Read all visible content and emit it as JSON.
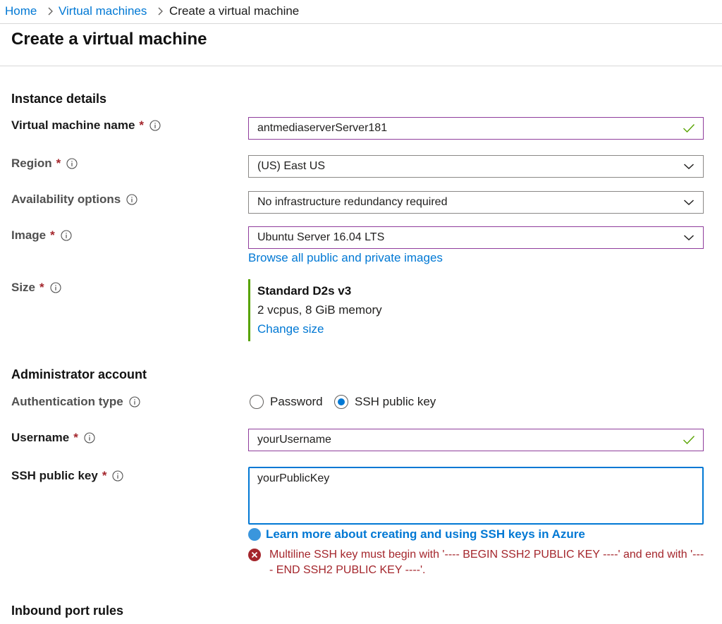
{
  "breadcrumb": {
    "home": "Home",
    "vms": "Virtual machines",
    "current": "Create a virtual machine"
  },
  "page_title": "Create a virtual machine",
  "sections": {
    "instance": "Instance details",
    "admin": "Administrator account",
    "inbound": "Inbound port rules"
  },
  "fields": {
    "vm_name": {
      "label": "Virtual machine name",
      "required": "*",
      "value": "antmediaserverServer181"
    },
    "region": {
      "label": "Region",
      "required": "*",
      "value": "(US) East US"
    },
    "availability": {
      "label": "Availability options",
      "value": "No infrastructure redundancy required"
    },
    "image": {
      "label": "Image",
      "required": "*",
      "value": "Ubuntu Server 16.04 LTS",
      "browse_link": "Browse all public and private images"
    },
    "size": {
      "label": "Size",
      "required": "*",
      "name": "Standard D2s v3",
      "desc": "2 vcpus, 8 GiB memory",
      "change_link": "Change size"
    },
    "auth_type": {
      "label": "Authentication type",
      "options": [
        "Password",
        "SSH public key"
      ],
      "selected": "SSH public key"
    },
    "username": {
      "label": "Username",
      "required": "*",
      "value": "yourUsername"
    },
    "ssh_key": {
      "label": "SSH public key",
      "required": "*",
      "value": "yourPublicKey",
      "learn_more": "Learn more about creating and using SSH keys in Azure",
      "error": "Multiline SSH key must begin with '---- BEGIN SSH2 PUBLIC KEY ----' and end with '---- END SSH2 PUBLIC KEY ----'."
    }
  },
  "colors": {
    "link": "#0078d4",
    "required": "#a4262c",
    "error": "#a4262c",
    "valid_check": "#57a300",
    "valid_border": "#8f3d9c",
    "size_accent": "#57a300",
    "focus_border": "#0078d4"
  },
  "icons": {
    "breadcrumb_sep": "chevron-right-icon",
    "info": "info-icon",
    "valid": "checkmark-icon",
    "dropdown": "chevron-down-icon",
    "learn": "info-dot-icon",
    "error": "error-x-icon"
  }
}
